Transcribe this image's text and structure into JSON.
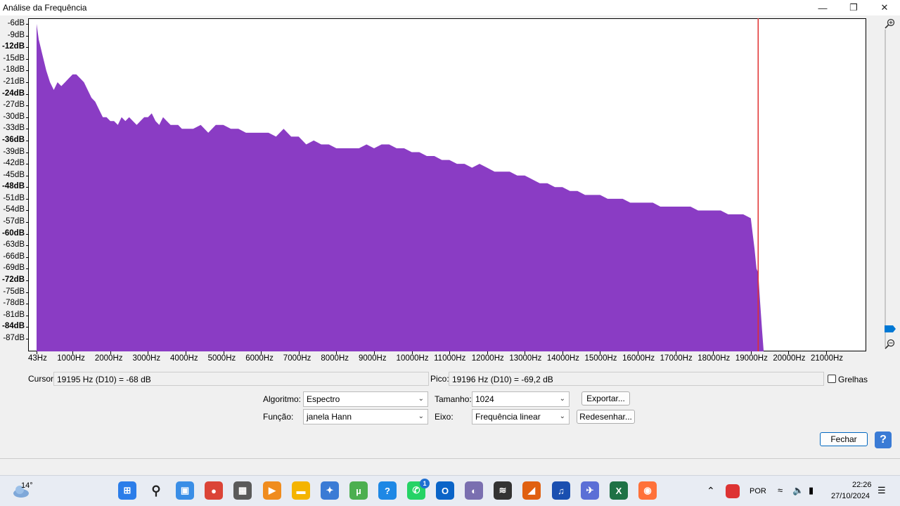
{
  "window": {
    "title": "Análise da Frequência",
    "minimize_glyph": "—",
    "maximize_glyph": "❐",
    "close_glyph": "✕"
  },
  "chart_data": {
    "type": "area",
    "color": "#8a3cc4",
    "cursor_color": "#e03030",
    "cursor_x": 19195,
    "xlim": [
      43,
      22050
    ],
    "ylim": [
      -90,
      -4
    ],
    "x_tick_labels": [
      "43Hz",
      "1000Hz",
      "2000Hz",
      "3000Hz",
      "4000Hz",
      "5000Hz",
      "6000Hz",
      "7000Hz",
      "8000Hz",
      "9000Hz",
      "10000Hz",
      "11000Hz",
      "12000Hz",
      "13000Hz",
      "14000Hz",
      "15000Hz",
      "16000Hz",
      "17000Hz",
      "18000Hz",
      "19000Hz",
      "20000Hz",
      "21000Hz"
    ],
    "x_tick_values": [
      43,
      1000,
      2000,
      3000,
      4000,
      5000,
      6000,
      7000,
      8000,
      9000,
      10000,
      11000,
      12000,
      13000,
      14000,
      15000,
      16000,
      17000,
      18000,
      19000,
      20000,
      21000
    ],
    "y_tick_labels": [
      "-6dB",
      "-9dB",
      "-12dB",
      "-15dB",
      "-18dB",
      "-21dB",
      "-24dB",
      "-27dB",
      "-30dB",
      "-33dB",
      "-36dB",
      "-39dB",
      "-42dB",
      "-45dB",
      "-48dB",
      "-51dB",
      "-54dB",
      "-57dB",
      "-60dB",
      "-63dB",
      "-66dB",
      "-69dB",
      "-72dB",
      "-75dB",
      "-78dB",
      "-81dB",
      "-84dB",
      "-87dB"
    ],
    "y_tick_values": [
      -6,
      -9,
      -12,
      -15,
      -18,
      -21,
      -24,
      -27,
      -30,
      -33,
      -36,
      -39,
      -42,
      -45,
      -48,
      -51,
      -54,
      -57,
      -60,
      -63,
      -66,
      -69,
      -72,
      -75,
      -78,
      -81,
      -84,
      -87
    ],
    "y_bold_labels": [
      "-12dB",
      "-24dB",
      "-36dB",
      "-48dB",
      "-60dB",
      "-72dB",
      "-84dB"
    ],
    "series": [
      {
        "x": [
          43,
          100,
          200,
          300,
          400,
          500,
          600,
          700,
          800,
          900,
          1000,
          1100,
          1200,
          1300,
          1400,
          1500,
          1600,
          1700,
          1800,
          1900,
          2000,
          2100,
          2200,
          2300,
          2400,
          2500,
          2600,
          2700,
          2800,
          2900,
          3000,
          3100,
          3200,
          3300,
          3400,
          3500,
          3600,
          3700,
          3800,
          3900,
          4000,
          4200,
          4400,
          4600,
          4800,
          5000,
          5200,
          5400,
          5600,
          5800,
          6000,
          6200,
          6400,
          6600,
          6800,
          7000,
          7200,
          7400,
          7600,
          7800,
          8000,
          8200,
          8400,
          8600,
          8800,
          9000,
          9200,
          9400,
          9600,
          9800,
          10000,
          10200,
          10400,
          10600,
          10800,
          11000,
          11200,
          11400,
          11600,
          11800,
          12000,
          12200,
          12400,
          12600,
          12800,
          13000,
          13200,
          13400,
          13600,
          13800,
          14000,
          14200,
          14400,
          14600,
          14800,
          15000,
          15200,
          15400,
          15600,
          15800,
          16000,
          16200,
          16400,
          16600,
          16800,
          17000,
          17200,
          17400,
          17600,
          17800,
          18000,
          18200,
          18400,
          18600,
          18800,
          19000,
          19050,
          19100,
          19150,
          19195,
          19250,
          19300,
          19340
        ],
        "y": [
          -6,
          -10,
          -14,
          -18,
          -21,
          -23,
          -21,
          -22,
          -21,
          -20,
          -19,
          -19,
          -20,
          -21,
          -23,
          -25,
          -26,
          -28,
          -30,
          -30,
          -31,
          -31,
          -32,
          -30,
          -31,
          -30,
          -31,
          -32,
          -31,
          -30,
          -30,
          -29,
          -31,
          -32,
          -30,
          -31,
          -32,
          -32,
          -32,
          -33,
          -33,
          -33,
          -32,
          -34,
          -32,
          -32,
          -33,
          -33,
          -34,
          -34,
          -34,
          -34,
          -35,
          -33,
          -35,
          -35,
          -37,
          -36,
          -37,
          -37,
          -38,
          -38,
          -38,
          -38,
          -37,
          -38,
          -37,
          -37,
          -38,
          -38,
          -39,
          -39,
          -40,
          -40,
          -41,
          -41,
          -42,
          -42,
          -43,
          -42,
          -43,
          -44,
          -44,
          -44,
          -45,
          -45,
          -46,
          -47,
          -47,
          -48,
          -48,
          -49,
          -49,
          -50,
          -50,
          -50,
          -51,
          -51,
          -51,
          -52,
          -52,
          -52,
          -52,
          -53,
          -53,
          -53,
          -53,
          -53,
          -54,
          -54,
          -54,
          -54,
          -55,
          -55,
          -55,
          -56,
          -60,
          -64,
          -69,
          -70,
          -78,
          -85,
          -90
        ]
      }
    ]
  },
  "readouts": {
    "cursor_label": "Cursor:",
    "cursor_value": "19195 Hz (D10) = -68 dB",
    "peak_label": "Pico:",
    "peak_value": "19196 Hz (D10) = -69,2 dB",
    "grid_label": "Grelhas",
    "grid_checked": false
  },
  "controls": {
    "algorithm_label": "Algoritmo:",
    "algorithm_value": "Espectro",
    "size_label": "Tamanho:",
    "size_value": "1024",
    "export_label": "Exportar...",
    "function_label": "Função:",
    "function_value": "janela Hann",
    "axis_label": "Eixo:",
    "axis_value": "Frequência linear",
    "redraw_label": "Redesenhar...",
    "close_label": "Fechar",
    "help_glyph": "?"
  },
  "taskbar": {
    "weather_temp": "14°",
    "language": "POR",
    "time": "22:26",
    "date": "27/10/2024",
    "whatsapp_badge": "1",
    "icons": [
      {
        "name": "start-icon",
        "color": "#2b7de9",
        "glyph": "⊞"
      },
      {
        "name": "search-icon",
        "color": "#e8ecf3",
        "glyph": "⚲"
      },
      {
        "name": "screenshot-icon",
        "color": "#3a8ee6",
        "glyph": "▣"
      },
      {
        "name": "chrome-icon",
        "color": "#db4437",
        "glyph": "●"
      },
      {
        "name": "calculator-icon",
        "color": "#5a5a5a",
        "glyph": "▦"
      },
      {
        "name": "media-player-icon",
        "color": "#f08c1e",
        "glyph": "▶"
      },
      {
        "name": "file-explorer-icon",
        "color": "#f4b400",
        "glyph": "▬"
      },
      {
        "name": "network-tool-icon",
        "color": "#3a7bd5",
        "glyph": "✦"
      },
      {
        "name": "utorrent-icon",
        "color": "#4caf50",
        "glyph": "µ"
      },
      {
        "name": "help-app-icon",
        "color": "#1e88e5",
        "glyph": "?"
      },
      {
        "name": "whatsapp-icon",
        "color": "#25d366",
        "glyph": "✆"
      },
      {
        "name": "outlook-icon",
        "color": "#0a64c8",
        "glyph": "O"
      },
      {
        "name": "browser-icon",
        "color": "#7a6fb0",
        "glyph": "◐"
      },
      {
        "name": "audio-wave-icon",
        "color": "#333333",
        "glyph": "≋"
      },
      {
        "name": "editor-icon",
        "color": "#e06010",
        "glyph": "◢"
      },
      {
        "name": "audacity-icon",
        "color": "#1a4fb0",
        "glyph": "♫"
      },
      {
        "name": "plane-app-icon",
        "color": "#5b6fd6",
        "glyph": "✈"
      },
      {
        "name": "excel-icon",
        "color": "#1e7145",
        "glyph": "X"
      },
      {
        "name": "firefox-icon",
        "color": "#ff7139",
        "glyph": "◉"
      }
    ]
  }
}
